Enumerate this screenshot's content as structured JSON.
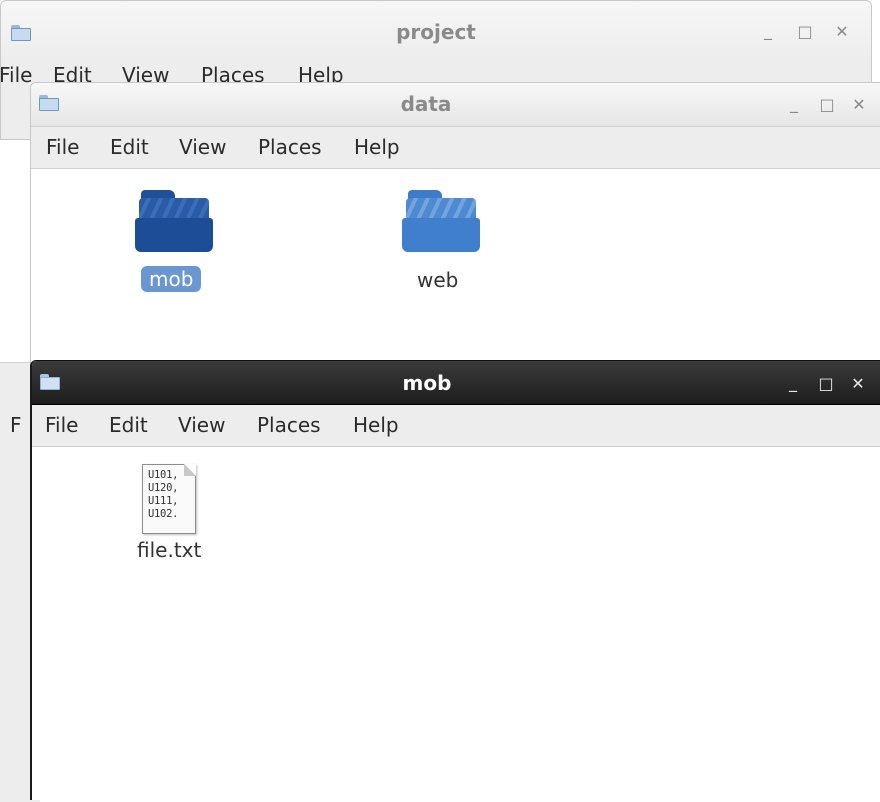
{
  "menu_items": [
    "File",
    "Edit",
    "View",
    "Places",
    "Help"
  ],
  "controls": {
    "minimize": "_",
    "maximize": "□",
    "close": "✕"
  },
  "windows": {
    "project": {
      "title": "project"
    },
    "background_window": {
      "menu_partial": "F"
    },
    "data": {
      "title": "data",
      "items": [
        {
          "name": "mob",
          "icon": "folder-icon",
          "selected": true
        },
        {
          "name": "web",
          "icon": "folder-icon",
          "selected": false
        }
      ]
    },
    "mob": {
      "title": "mob",
      "items": [
        {
          "name": "file.txt",
          "icon": "text-file-icon",
          "preview": [
            "U101,",
            "U120,",
            "U111,",
            "U102."
          ]
        }
      ]
    }
  },
  "colors": {
    "selection": "#6a97d1",
    "folder_dark": "#1d4d96",
    "folder_light": "#3f7fcc",
    "active_titlebar": "#2a2a2a"
  }
}
